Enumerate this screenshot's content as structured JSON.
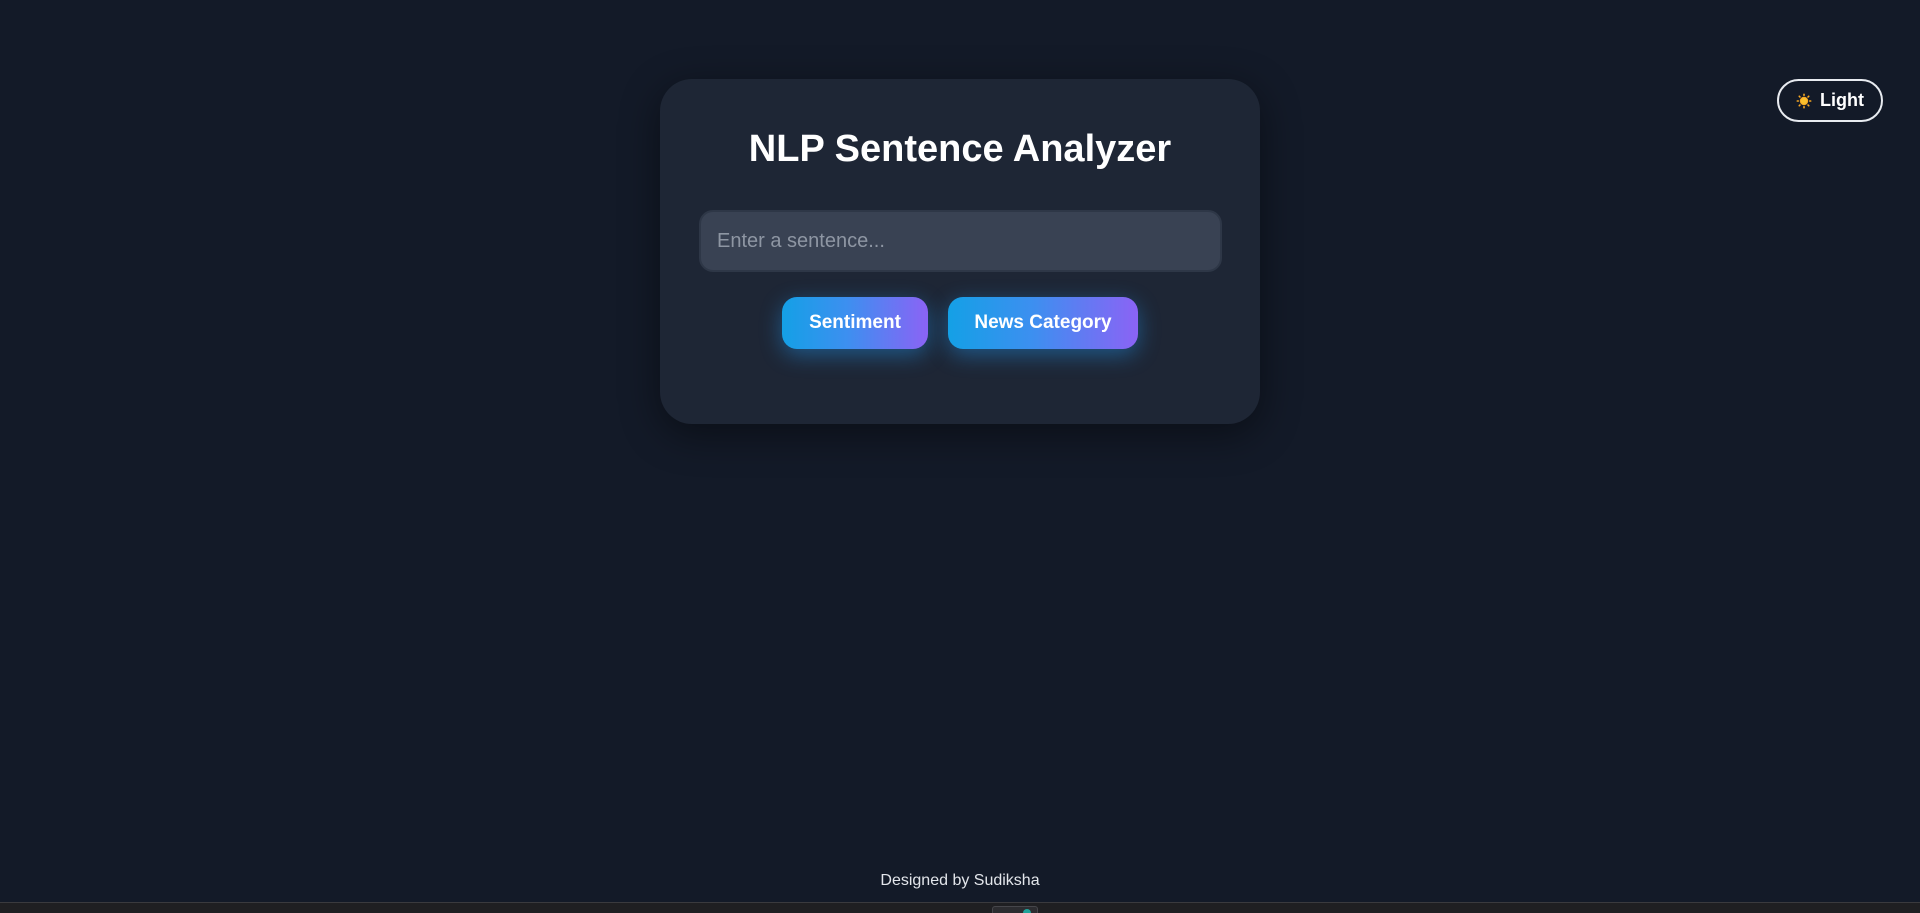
{
  "theme_toggle": {
    "icon": "sun-icon",
    "label": "Light"
  },
  "card": {
    "title": "NLP Sentence Analyzer",
    "input": {
      "placeholder": "Enter a sentence...",
      "value": ""
    },
    "buttons": {
      "sentiment_label": "Sentiment",
      "news_category_label": "News Category"
    }
  },
  "footer": {
    "text": "Designed by Sudiksha"
  },
  "colors": {
    "background": "#131a28",
    "card": "#1e2635",
    "button_gradient_start": "#14a0e6",
    "button_gradient_end": "#8b63f5"
  }
}
